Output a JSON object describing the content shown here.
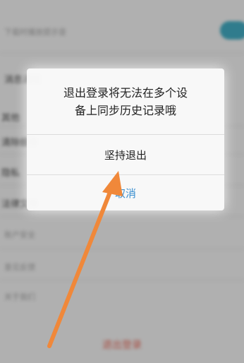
{
  "background": {
    "rows": [
      {
        "label": "下载时播放提示音",
        "faint": true
      },
      {
        "label": "消息通知",
        "faint": false
      },
      {
        "label": "其他",
        "faint": false
      },
      {
        "label": "清除缓存",
        "faint": false
      },
      {
        "label": "隐私",
        "faint": false
      },
      {
        "label": "法律文件",
        "faint": false
      },
      {
        "label": "账户安全",
        "faint": true
      },
      {
        "label": "意见反馈",
        "faint": true
      },
      {
        "label": "关于我们",
        "faint": true
      }
    ],
    "logout_label": "退出登录"
  },
  "dialog": {
    "message_line1": "退出登录将无法在多个设",
    "message_line2": "备上同步历史记录哦",
    "confirm_label": "坚持退出",
    "cancel_label": "取消"
  },
  "colors": {
    "accent": "#3a8fd0",
    "arrow": "#f0883a",
    "toggle": "#2a9fb8",
    "logout": "#e25b4a"
  }
}
